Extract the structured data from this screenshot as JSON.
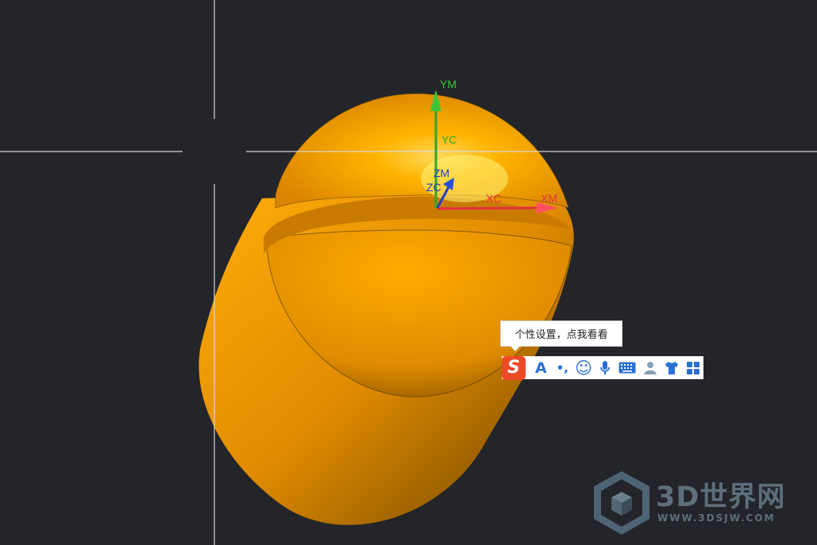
{
  "viewport": {
    "background": "#24252a",
    "model_color": "#f2a000",
    "axes": {
      "ym": "YM",
      "yc": "YC",
      "zm": "ZM",
      "zc": "ZC",
      "xm": "XM",
      "xc": "XC"
    },
    "axis_colors": {
      "y": "#2fa52c",
      "z": "#1f3fc6",
      "x": "#e23040"
    }
  },
  "ime": {
    "tooltip": "个性设置，点我看看",
    "logo": "S",
    "buttons": {
      "font": "A",
      "punct": "•,",
      "emoji": "☺",
      "voice": "🎤",
      "keyboard": "⌨",
      "user": "👤",
      "skin": "👕",
      "toolbox": "▦"
    },
    "accent": "#2a6fd6",
    "logo_color": "#ef4a28"
  },
  "watermark": {
    "title": "3D世界网",
    "url": "WWW.3DSJW.COM"
  }
}
